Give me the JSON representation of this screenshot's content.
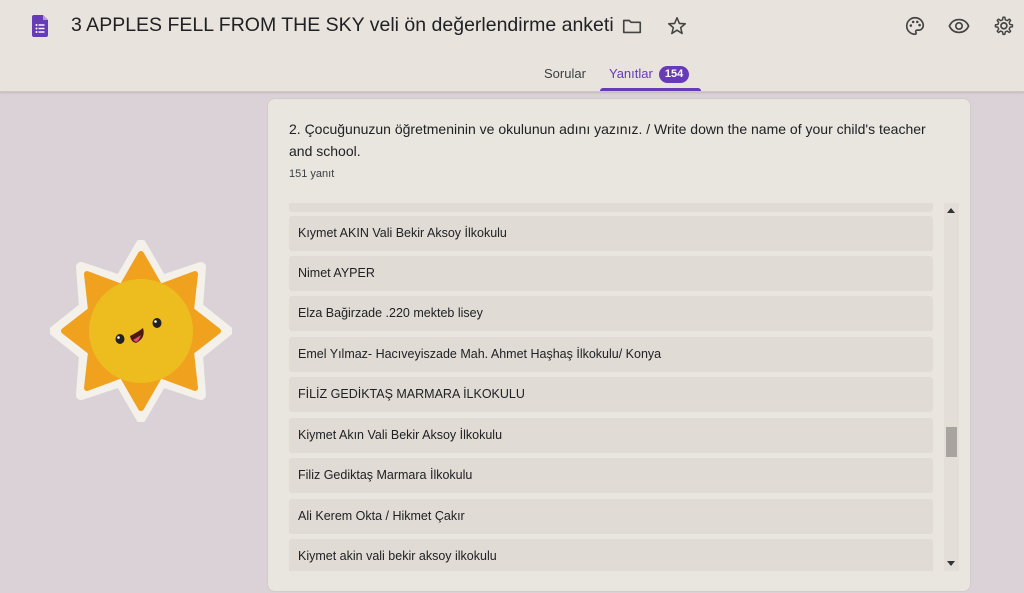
{
  "header": {
    "title": "3 APPLES FELL FROM THE SKY veli ön değerlendirme anketi",
    "icons": [
      "forms-logo-icon",
      "folder-icon",
      "star-icon",
      "palette-icon",
      "eye-icon",
      "settings-icon"
    ]
  },
  "tabs": [
    {
      "label": "Sorular",
      "active": false
    },
    {
      "label": "Yanıtlar",
      "active": true,
      "badge": "154"
    }
  ],
  "colors": {
    "accent": "#673ab7",
    "header_bg": "#e8e3dc",
    "page_bg": "#dbd2d8",
    "card_bg": "#e9e5df"
  },
  "question": {
    "text": "2. Çocuğunuzun öğretmeninin ve okulunun adını yazınız. / Write down the name of your child's teacher and school.",
    "response_count": "151 yanıt",
    "responses": [
      "Kıymet AKIN Vali Bekir Aksoy İlkokulu",
      "Nimet AYPER",
      "Elza Bağirzade .220 mekteb lisey",
      "Emel Yılmaz- Hacıveyiszade Mah. Ahmet Haşhaş İlkokulu/ Konya",
      "FİLİZ GEDİKTAŞ MARMARA İLKOKULU",
      "Kiymet Akın Vali Bekir Aksoy İlkokulu",
      "Filiz Gediktaş Marmara İlkokulu",
      "Ali Kerem Okta / Hikmet Çakır",
      "Kiymet akin vali bekir aksoy ilkokulu"
    ]
  }
}
